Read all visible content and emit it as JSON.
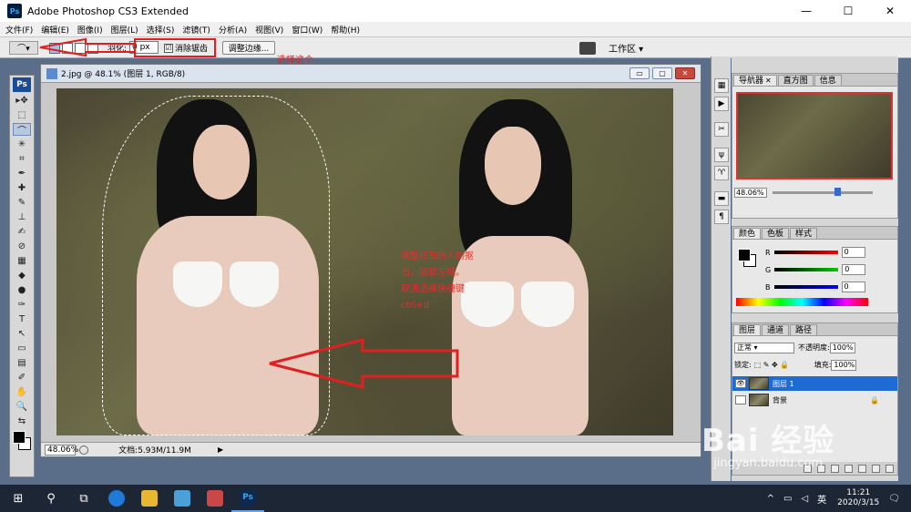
{
  "window": {
    "app_icon": "Ps",
    "title": "Adobe Photoshop CS3 Extended",
    "minimize": "—",
    "maximize": "☐",
    "close": "✕"
  },
  "menubar": {
    "items": [
      "文件(F)",
      "编辑(E)",
      "图像(I)",
      "图层(L)",
      "选择(S)",
      "滤镜(T)",
      "分析(A)",
      "视图(V)",
      "窗口(W)",
      "帮助(H)"
    ]
  },
  "options": {
    "feather_label": "羽化:",
    "feather_value": "0 px",
    "antialias_label": "消除锯齿",
    "antialias_checked": "☑",
    "refine_edge": "调整边缘...",
    "workspace": "工作区 ▾",
    "annotation": "选择这个"
  },
  "toolbox": {
    "badge": "Ps",
    "tools": [
      "▸✥",
      "⬚",
      "⌒",
      "✳",
      "⌗",
      "✒",
      "✚",
      "✎",
      "⊥",
      "✍",
      "⊘",
      "▦",
      "◆",
      "●",
      "✑",
      "T",
      "↖",
      "▭",
      "▤",
      "✐",
      "✋",
      "🔍",
      "⇆"
    ]
  },
  "document": {
    "title": "2.jpg @ 48.1% (图层 1, RGB/8)",
    "btn_min": "▭",
    "btn_max": "▢",
    "btn_close": "✕",
    "annotation_lines": [
      "调整好后的人物抠",
      "出，鼠标左键。",
      "取消选择快捷键",
      "ctrl+d"
    ],
    "zoom": "48.06%",
    "doc_info": "文档:5.93M/11.9M",
    "status_arrow": "▶"
  },
  "dock": {
    "icons": [
      "▦",
      "▶",
      "✂",
      "ψ",
      "♈",
      "▬",
      "¶"
    ]
  },
  "navigator": {
    "tabs": [
      "导航器",
      "直方图",
      "信息"
    ],
    "close_glyph": "✕",
    "zoom": "48.06%",
    "slider_fraction": 0.62
  },
  "color_panel": {
    "tabs": [
      "颜色",
      "色板",
      "样式"
    ],
    "r_label": "R",
    "g_label": "G",
    "b_label": "B",
    "r_value": "0",
    "g_value": "0",
    "b_value": "0"
  },
  "layers": {
    "tabs": [
      "图层",
      "通道",
      "路径"
    ],
    "blend_mode": "正常 ▾",
    "opacity_label": "不透明度:",
    "opacity_value": "100%",
    "lock_label": "锁定:",
    "lock_icons": "⬚ ✎ ✥ 🔒",
    "fill_label": "填充:",
    "fill_value": "100%",
    "eye_glyph": "👁",
    "rows": [
      {
        "name": "图层 1"
      },
      {
        "name": "背景"
      }
    ],
    "lock_glyph": "🔒"
  },
  "taskbar": {
    "start": "⊞",
    "search": "⚲",
    "taskview": "⧉",
    "ps_label": "Ps",
    "tray_up": "^",
    "lang": "英",
    "time": "11:21",
    "date": "2020/3/15",
    "notif": "🗨"
  },
  "watermark": {
    "logo": "Bai 经验",
    "url": "jingyan.baidu.com"
  },
  "colors": {
    "annotation_red": "#e02020",
    "active_layer": "#1f6bd4"
  }
}
